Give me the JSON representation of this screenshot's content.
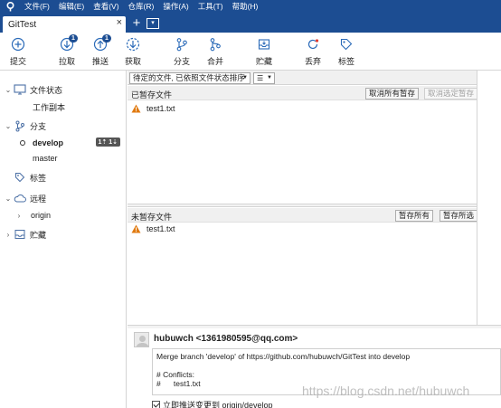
{
  "menu": [
    "文件(F)",
    "编辑(E)",
    "查看(V)",
    "仓库(R)",
    "操作(A)",
    "工具(T)",
    "帮助(H)"
  ],
  "tab": {
    "title": "GitTest",
    "close": "×",
    "add": "+",
    "menu": "▾"
  },
  "toolbar": [
    {
      "label": "提交",
      "icon": "commit-icon"
    },
    {
      "label": "拉取",
      "icon": "pull-icon",
      "badge": "1"
    },
    {
      "label": "推送",
      "icon": "push-icon",
      "badge": "1"
    },
    {
      "label": "获取",
      "icon": "fetch-icon"
    },
    {
      "label": "分支",
      "icon": "branch-icon"
    },
    {
      "label": "合并",
      "icon": "merge-icon"
    },
    {
      "label": "贮藏",
      "icon": "stash-icon"
    },
    {
      "label": "丢弃",
      "icon": "discard-icon"
    },
    {
      "label": "标签",
      "icon": "tag-icon"
    }
  ],
  "sidebar": {
    "file_status": "文件状态",
    "working_copy": "工作副本",
    "branches": "分支",
    "develop": "develop",
    "develop_counts": "1⇡ 1⇣",
    "master": "master",
    "tags": "标签",
    "remotes": "远程",
    "origin": "origin",
    "stashes": "贮藏"
  },
  "filter": {
    "selected": "待定的文件, 已依照文件状态排序",
    "view": "☰"
  },
  "staged": {
    "title": "已暂存文件",
    "unstage_all": "取消所有暂存",
    "unstage_selected": "取消选定暂存",
    "files": [
      "test1.txt"
    ]
  },
  "unstaged": {
    "title": "未暂存文件",
    "stage_all": "暂存所有",
    "stage_selected": "暂存所选",
    "files": [
      "test1.txt"
    ]
  },
  "commit": {
    "author": "hubuwch <1361980595@qq.com>",
    "message_lines": [
      "Merge branch 'develop' of https://github.com/hubuwch/GitTest into develop",
      "",
      "# Conflicts:",
      "#\ttest1.txt"
    ],
    "push_label": "立即推送变更到 origin/develop"
  },
  "watermark": "https://blog.csdn.net/hubuwch",
  "colors": {
    "accent": "#1c4d92",
    "warning": "#e07a10"
  }
}
